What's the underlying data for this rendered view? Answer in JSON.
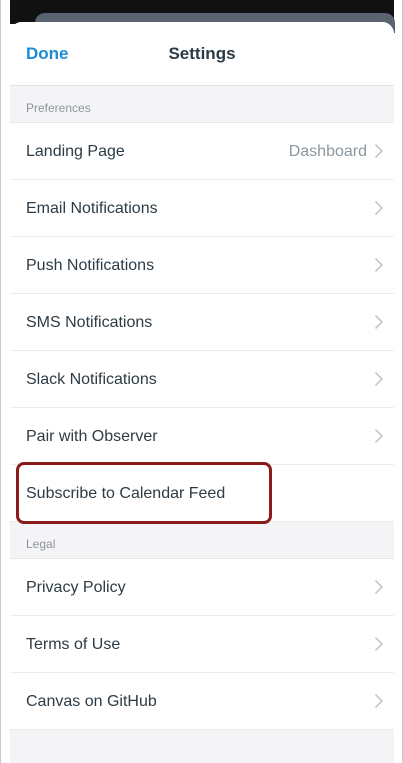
{
  "navbar": {
    "done_label": "Done",
    "title": "Settings"
  },
  "sections": {
    "preferences": {
      "header": "Preferences",
      "rows": {
        "landing_page": {
          "label": "Landing Page",
          "value": "Dashboard"
        },
        "email": {
          "label": "Email Notifications"
        },
        "push": {
          "label": "Push Notifications"
        },
        "sms": {
          "label": "SMS Notifications"
        },
        "slack": {
          "label": "Slack Notifications"
        },
        "observer": {
          "label": "Pair with Observer"
        },
        "calendar": {
          "label": "Subscribe to Calendar Feed"
        }
      }
    },
    "legal": {
      "header": "Legal",
      "rows": {
        "privacy": {
          "label": "Privacy Policy"
        },
        "terms": {
          "label": "Terms of Use"
        },
        "github": {
          "label": "Canvas on GitHub"
        }
      }
    }
  },
  "colors": {
    "accent": "#1c8bd1",
    "text": "#2d3b45",
    "secondary_text": "#8b969e",
    "highlight_border": "#8b1a1a"
  },
  "icons": {
    "row_disclosure": "chevron-right-icon"
  }
}
